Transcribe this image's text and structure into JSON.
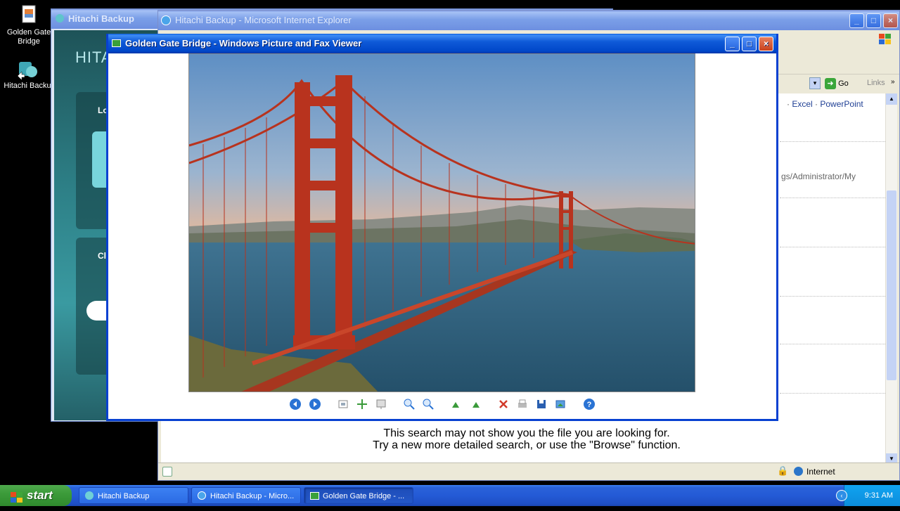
{
  "desktop": {
    "icons": [
      {
        "label": "Golden Gate Bridge"
      },
      {
        "label": "Hitachi Backu"
      }
    ]
  },
  "hitachi_window": {
    "title": "Hitachi Backup",
    "brand_partial": "HITA",
    "side_labels": [
      "Lo",
      "Cl"
    ]
  },
  "ie_window": {
    "title": "Hitachi Backup - Microsoft Internet Explorer",
    "go_label": "Go",
    "links_label": "Links",
    "office_links": [
      "Excel",
      "PowerPoint"
    ],
    "path_fragment": "gs/Administrator/My",
    "message_line1": "This search may not show you the file you are looking for.",
    "message_line2": "Try a new more detailed search, or use the \"Browse\" function.",
    "status_zone": "Internet"
  },
  "viewer_window": {
    "title": "Golden Gate Bridge - Windows Picture and Fax Viewer",
    "toolbar_icons": [
      "previous-image-icon",
      "next-image-icon",
      "best-fit-icon",
      "actual-size-icon",
      "slideshow-icon",
      "zoom-in-icon",
      "zoom-out-icon",
      "rotate-clockwise-icon",
      "rotate-counterclockwise-icon",
      "delete-icon",
      "print-icon",
      "save-icon",
      "edit-icon",
      "help-icon"
    ]
  },
  "taskbar": {
    "start_label": "start",
    "tasks": [
      {
        "label": "Hitachi Backup"
      },
      {
        "label": "Hitachi Backup - Micro..."
      },
      {
        "label": "Golden Gate Bridge - ..."
      }
    ],
    "clock": "9:31 AM"
  },
  "colors": {
    "xp_blue": "#0841d1",
    "bridge_red": "#b8331e",
    "sky_top": "#5e8fc4",
    "sky_horizon": "#e8b99a",
    "water": "#2e5f80"
  }
}
